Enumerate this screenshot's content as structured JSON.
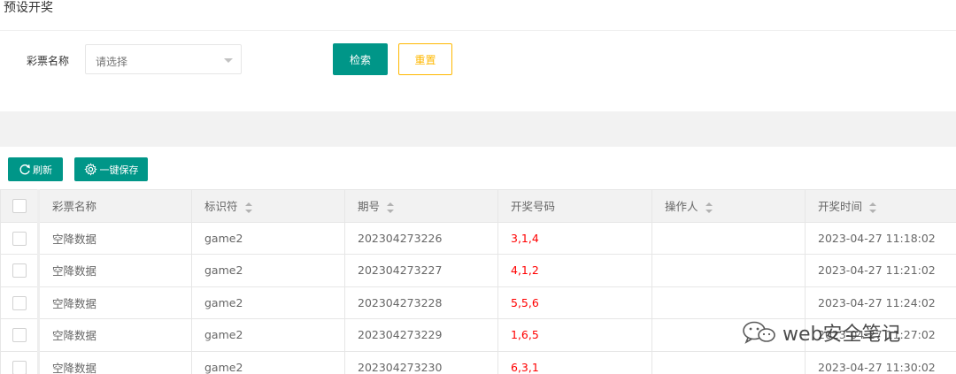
{
  "page": {
    "title": "预设开奖"
  },
  "search": {
    "label": "彩票名称",
    "placeholder": "请选择",
    "search_label": "检索",
    "reset_label": "重置"
  },
  "toolbar": {
    "refresh_label": "刷新",
    "save_label": "一键保存"
  },
  "table": {
    "headers": [
      "彩票名称",
      "标识符",
      "期号",
      "开奖号码",
      "操作人",
      "开奖时间"
    ],
    "rows": [
      {
        "name": "空降数据",
        "id": "game2",
        "period": "202304273226",
        "numbers": "3,1,4",
        "operator": "",
        "time": "2023-04-27 11:18:02"
      },
      {
        "name": "空降数据",
        "id": "game2",
        "period": "202304273227",
        "numbers": "4,1,2",
        "operator": "",
        "time": "2023-04-27 11:21:02"
      },
      {
        "name": "空降数据",
        "id": "game2",
        "period": "202304273228",
        "numbers": "5,5,6",
        "operator": "",
        "time": "2023-04-27 11:24:02"
      },
      {
        "name": "空降数据",
        "id": "game2",
        "period": "202304273229",
        "numbers": "1,6,5",
        "operator": "",
        "time": "2023-04-27 11:27:02"
      },
      {
        "name": "空降数据",
        "id": "game2",
        "period": "202304273230",
        "numbers": "6,3,1",
        "operator": "",
        "time": "2023-04-27 11:30:02"
      }
    ]
  },
  "watermark": {
    "text": "web安全笔记"
  },
  "colors": {
    "primary": "#009688",
    "warning": "#ffb800",
    "draw_numbers": "#ff0000"
  }
}
